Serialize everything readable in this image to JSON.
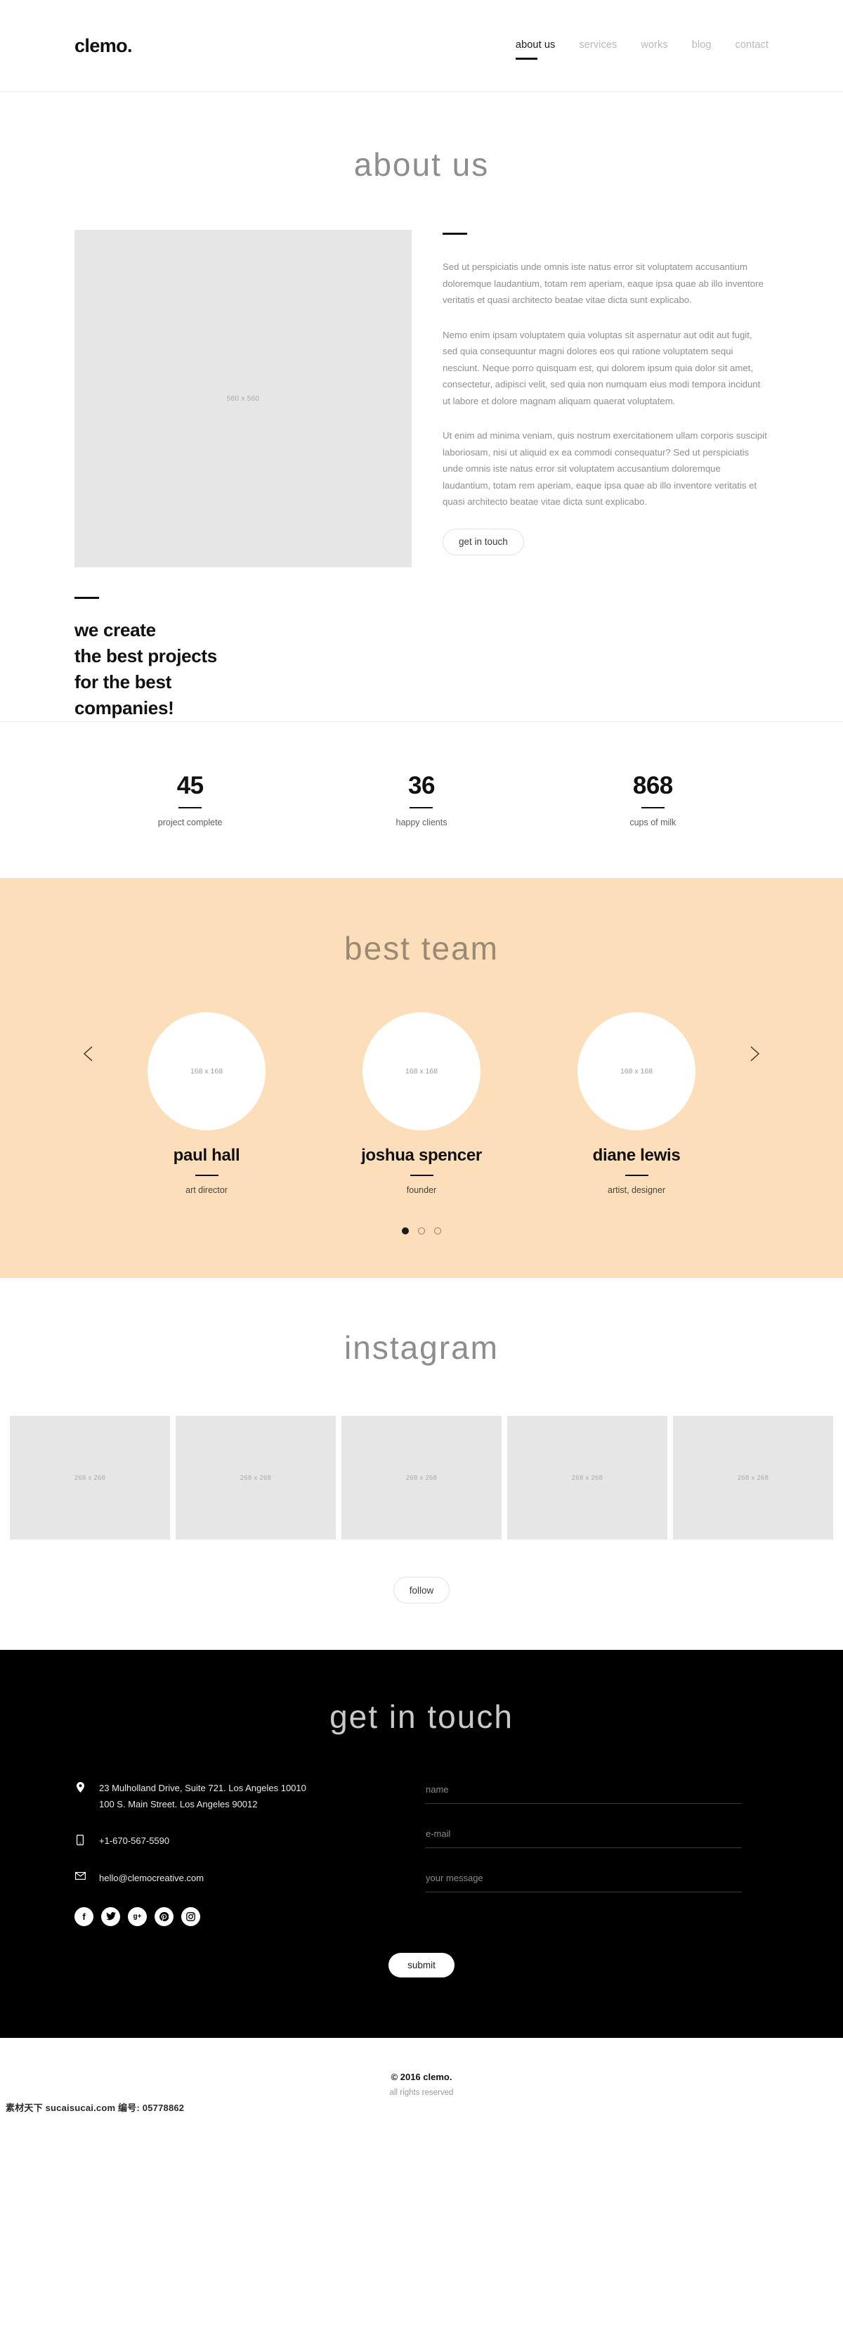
{
  "header": {
    "logo": "clemo.",
    "nav": [
      {
        "label": "about us",
        "active": true
      },
      {
        "label": "services",
        "active": false
      },
      {
        "label": "works",
        "active": false
      },
      {
        "label": "blog",
        "active": false
      },
      {
        "label": "contact",
        "active": false
      }
    ]
  },
  "about": {
    "title": "about us",
    "image_placeholder": "560 x 560",
    "heading_line1": "we create",
    "heading_line2": "the best projects",
    "heading_line3": "for the best",
    "heading_line4": "companies!",
    "paragraphs": [
      "Sed ut perspiciatis unde omnis iste natus error sit voluptatem accusantium doloremque laudantium, totam rem aperiam, eaque ipsa quae ab illo inventore veritatis et quasi architecto beatae vitae dicta sunt explicabo.",
      "Nemo enim ipsam voluptatem quia voluptas sit aspernatur aut odit aut fugit, sed quia consequuntur magni dolores eos qui ratione voluptatem sequi nesciunt. Neque porro quisquam est, qui dolorem ipsum quia dolor sit amet, consectetur, adipisci velit, sed quia non numquam eius modi tempora incidunt ut labore et dolore magnam aliquam quaerat voluptatem.",
      "Ut enim ad minima veniam, quis nostrum exercitationem ullam corporis suscipit laboriosam, nisi ut aliquid ex ea commodi consequatur? Sed ut perspiciatis unde omnis iste natus error sit voluptatem accusantium doloremque laudantium, totam rem aperiam, eaque ipsa quae ab illo inventore veritatis et quasi architecto beatae vitae dicta sunt explicabo."
    ],
    "cta_label": "get in touch"
  },
  "stats": [
    {
      "number": "45",
      "label": "project complete"
    },
    {
      "number": "36",
      "label": "happy clients"
    },
    {
      "number": "868",
      "label": "cups of milk"
    }
  ],
  "team": {
    "title": "best team",
    "accent_bg": "#fcdfba",
    "members": [
      {
        "avatar_placeholder": "168 x 168",
        "name": "paul hall",
        "role": "art director"
      },
      {
        "avatar_placeholder": "168 x 168",
        "name": "joshua spencer",
        "role": "founder"
      },
      {
        "avatar_placeholder": "168 x 168",
        "name": "diane lewis",
        "role": "artist, designer"
      }
    ],
    "prev_icon": "chevron-left-icon",
    "next_icon": "chevron-right-icon",
    "dots": [
      true,
      false,
      false
    ]
  },
  "instagram": {
    "title": "instagram",
    "tiles": [
      "268 x 268",
      "268 x 268",
      "268 x 268",
      "268 x 268",
      "268 x 268"
    ],
    "follow_label": "follow"
  },
  "footer": {
    "title": "get in touch",
    "address_line1": "23 Mulholland Drive, Suite 721. Los Angeles 10010",
    "address_line2": "100 S. Main Street. Los Angeles 90012",
    "phone": "+1-670-567-5590",
    "email": "hello@clemocreative.com",
    "socials": [
      {
        "icon": "facebook-icon",
        "glyph": "f"
      },
      {
        "icon": "twitter-icon",
        "glyph": "ᵗ"
      },
      {
        "icon": "google-plus-icon",
        "glyph": "g+"
      },
      {
        "icon": "pinterest-icon",
        "glyph": "ⓟ"
      },
      {
        "icon": "instagram-icon",
        "glyph": "▣"
      }
    ],
    "form": {
      "name_placeholder": "name",
      "email_placeholder": "e-mail",
      "message_placeholder": "your message",
      "submit_label": "submit"
    },
    "copyright": "© 2016 clemo.",
    "rights": "all rights reserved"
  },
  "watermark": "素材天下 sucaisucai.com  编号: 05778862"
}
